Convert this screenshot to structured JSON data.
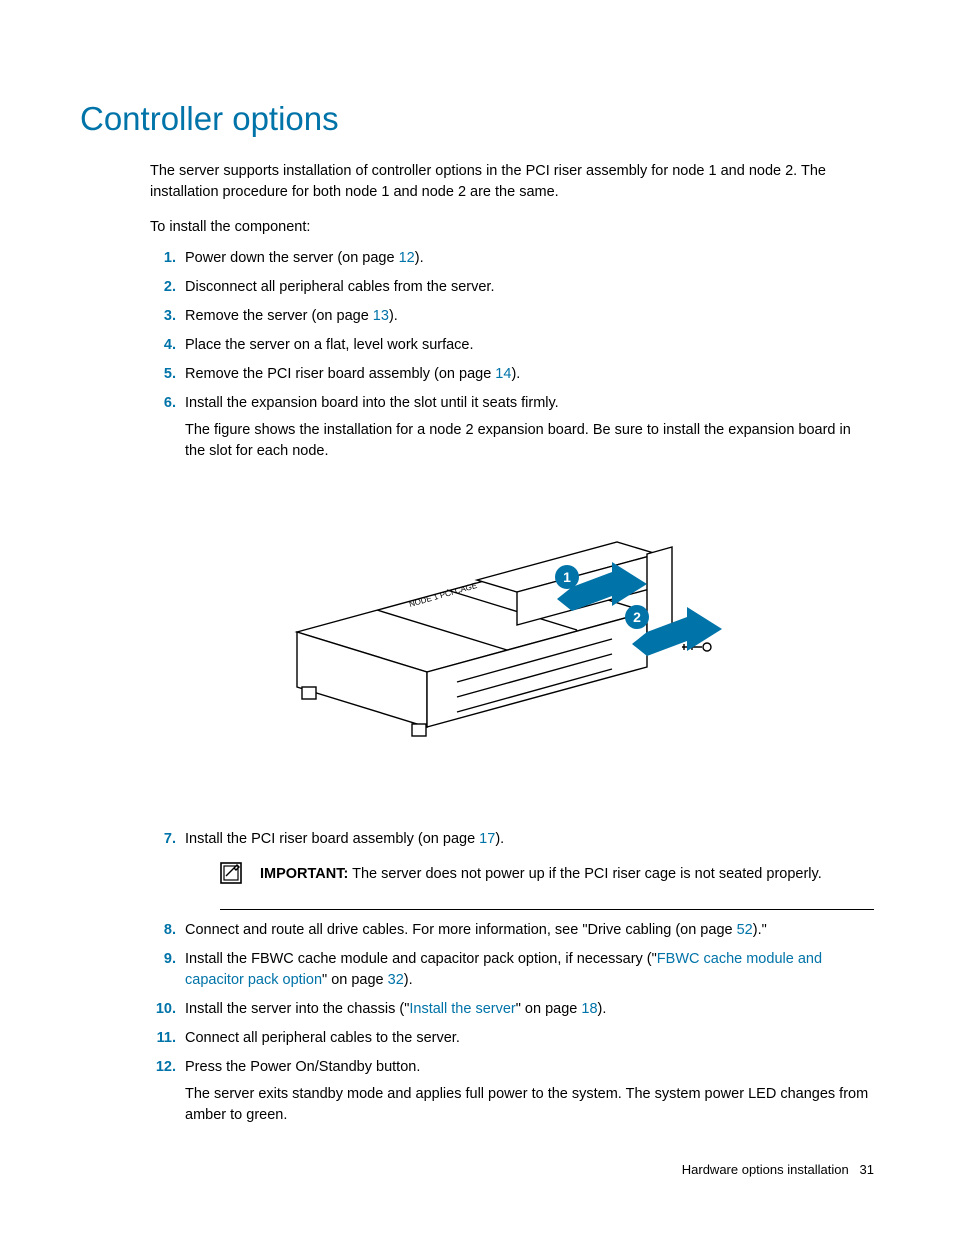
{
  "title": "Controller options",
  "intro": "The server supports installation of controller options in the PCI riser assembly for node 1 and node 2. The installation procedure for both node 1 and node 2 are the same.",
  "lead": "To install the component:",
  "steps_a": {
    "s1": {
      "num": "1.",
      "pre": "Power down the server (on page ",
      "link": "12",
      "post": ")."
    },
    "s2": {
      "num": "2.",
      "text": "Disconnect all peripheral cables from the server."
    },
    "s3": {
      "num": "3.",
      "pre": "Remove the server (on page ",
      "link": "13",
      "post": ")."
    },
    "s4": {
      "num": "4.",
      "text": "Place the server on a flat, level work surface."
    },
    "s5": {
      "num": "5.",
      "pre": "Remove the PCI riser board assembly (on page ",
      "link": "14",
      "post": ")."
    },
    "s6": {
      "num": "6.",
      "text": "Install the expansion board into the slot until it seats firmly.",
      "sub": "The figure shows the installation for a node 2 expansion board. Be sure to install the expansion board in the slot for each node."
    }
  },
  "figure": {
    "callout1": "1",
    "callout2": "2",
    "cage_label": "NODE 1 PCI CAGE"
  },
  "steps_b": {
    "s7": {
      "num": "7.",
      "pre": "Install the PCI riser board assembly (on page ",
      "link": "17",
      "post": ")."
    },
    "important": {
      "label": "IMPORTANT:",
      "text": "  The server does not power up if the PCI riser cage is not seated properly."
    },
    "s8": {
      "num": "8.",
      "pre": "Connect and route all drive cables. For more information, see \"Drive cabling (on page ",
      "link": "52",
      "post": ").\""
    },
    "s9": {
      "num": "9.",
      "pre": "Install the FBWC cache module and capacitor pack option, if necessary (\"",
      "link1": "FBWC cache module and capacitor pack option",
      "mid": "\" on page ",
      "link2": "32",
      "post": ")."
    },
    "s10": {
      "num": "10.",
      "pre": "Install the server into the chassis (\"",
      "link1": "Install the server",
      "mid": "\" on page ",
      "link2": "18",
      "post": ")."
    },
    "s11": {
      "num": "11.",
      "text": "Connect all peripheral cables to the server."
    },
    "s12": {
      "num": "12.",
      "text": "Press the Power On/Standby button.",
      "sub": "The server exits standby mode and applies full power to the system. The system power LED changes from amber to green."
    }
  },
  "footer": {
    "label": "Hardware options installation",
    "page": "31"
  }
}
